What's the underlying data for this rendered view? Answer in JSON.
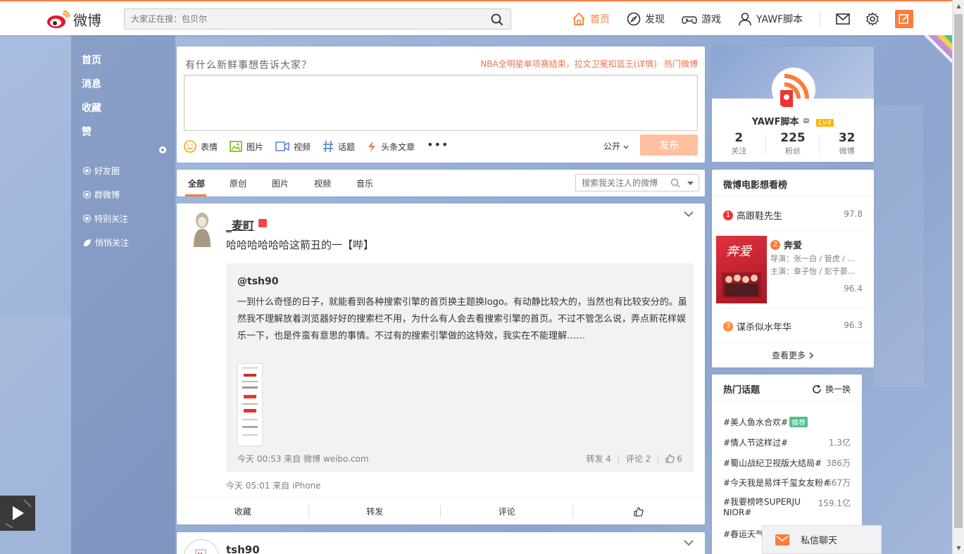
{
  "header": {
    "logo_text": "微博",
    "search_placeholder": "大家正在搜：包贝尔",
    "nav": [
      {
        "label": "首页",
        "icon": "home-icon",
        "active": true
      },
      {
        "label": "发现",
        "icon": "compass-icon"
      },
      {
        "label": "游戏",
        "icon": "gamepad-icon"
      },
      {
        "label": "YAWF脚本",
        "icon": "user-icon"
      }
    ]
  },
  "leftnav": {
    "main": [
      "首页",
      "消息",
      "收藏",
      "赞"
    ],
    "groups": [
      "好友圈",
      "群微博",
      "特别关注",
      "悄悄关注"
    ]
  },
  "composer": {
    "title": "有什么新鲜事想告诉大家？",
    "hot_text": "NBA全明星单项赛结束，拉文卫冕扣篮王(详情)",
    "hot_link": "热门微博",
    "tools": [
      "表情",
      "图片",
      "视频",
      "话题",
      "头条文章"
    ],
    "more": "•••",
    "visibility": "公开",
    "send": "发布"
  },
  "tabs": {
    "items": [
      "全部",
      "原创",
      "图片",
      "视频",
      "音乐"
    ],
    "search_placeholder": "搜索我关注人的微博"
  },
  "feed": [
    {
      "user": "_麦町",
      "content": "哈哈哈哈哈哈这箭丑的一【哔】",
      "repost": {
        "user": "@tsh90",
        "text": "一到什么奇怪的日子，就能看到各种搜索引擎的首页换主题换logo。有动静比较大的，当然也有比较安分的。虽然我不理解放着浏览器好好的搜索栏不用，为什么有人会去看搜索引擎的首页。不过不管怎么说，弄点新花样娱乐一下，也是件蛮有意思的事情。不过有的搜索引擎做的这特效，我实在不能理解……",
        "meta": "今天 00:53 来自 微博 weibo.com",
        "forward": "转发 4",
        "comment": "评论 2",
        "like": "6"
      },
      "meta": "今天 05:01 来自 iPhone",
      "actions": [
        "收藏",
        "转发",
        "评论"
      ]
    },
    {
      "user": "tsh90"
    }
  ],
  "profile": {
    "name": "YAWF脚本",
    "level": "Lv4",
    "stats": [
      {
        "num": "2",
        "label": "关注"
      },
      {
        "num": "225",
        "label": "粉丝"
      },
      {
        "num": "32",
        "label": "微博"
      }
    ]
  },
  "movies": {
    "title": "微博电影想看榜",
    "items": [
      {
        "rank": "1",
        "name": "高跟鞋先生",
        "score": "97.8"
      },
      {
        "rank": "2",
        "name": "奔爱",
        "director": "导演：张一白 / 管虎 / ...",
        "cast": "主演：章子怡 / 彭于晏...",
        "score": "96.4"
      },
      {
        "rank": "3",
        "name": "谋杀似水年华",
        "score": "96.3"
      }
    ],
    "more": "查看更多"
  },
  "topics": {
    "title": "热门话题",
    "refresh": "换一换",
    "rec_tag": "推荐",
    "items": [
      {
        "name": "#美人鱼水合欢#",
        "count": ""
      },
      {
        "name": "#情人节这样过#",
        "count": "1.3亿"
      },
      {
        "name": "#蜀山战纪卫视版大结局#",
        "count": "386万"
      },
      {
        "name": "#今天我是易烊千玺女友粉#",
        "count": "667万"
      },
      {
        "name": "#我要榜咚SUPERJUNIOR#",
        "count": "159.1亿"
      },
      {
        "name": "#春运天气",
        "count": ""
      }
    ]
  },
  "chat": {
    "label": "私信聊天"
  },
  "colors": {
    "accent": "#fa7d3c",
    "link_hot": "#eb7350"
  }
}
